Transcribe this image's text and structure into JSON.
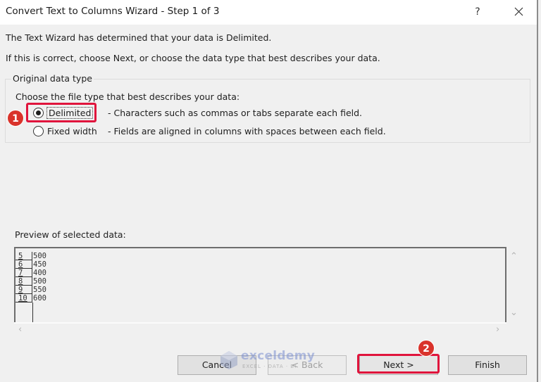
{
  "window": {
    "title": "Convert Text to Columns Wizard - Step 1 of 3",
    "help_label": "?",
    "close_icon": "close-icon"
  },
  "intro": {
    "line1": "The Text Wizard has determined that your data is Delimited.",
    "line2": "If this is correct, choose Next, or choose the data type that best describes your data."
  },
  "original_data_type": {
    "legend": "Original data type",
    "prompt": "Choose the file type that best describes your data:",
    "options": [
      {
        "label": "Delimited",
        "accel": "D",
        "description": "- Characters such as commas or tabs separate each field.",
        "selected": true
      },
      {
        "label": "Fixed width",
        "accel": "w",
        "description": "- Fields are aligned in columns with spaces between each field.",
        "selected": false
      }
    ]
  },
  "preview": {
    "label": "Preview of selected data:",
    "rows": [
      {
        "num": "5",
        "value": "500"
      },
      {
        "num": "6",
        "value": "450"
      },
      {
        "num": "7",
        "value": "400"
      },
      {
        "num": "8",
        "value": "500"
      },
      {
        "num": "9",
        "value": "550"
      },
      {
        "num": "10",
        "value": "600"
      }
    ]
  },
  "buttons": {
    "cancel": "Cancel",
    "back": "< Back",
    "next": "Next >",
    "finish": "Finish"
  },
  "annotations": {
    "step1": "1",
    "step2": "2",
    "highlight_color": "#e0143c",
    "badge_color": "#d9332b"
  },
  "watermark": {
    "name": "exceldemy",
    "tagline": "EXCEL · DATA · BI"
  }
}
